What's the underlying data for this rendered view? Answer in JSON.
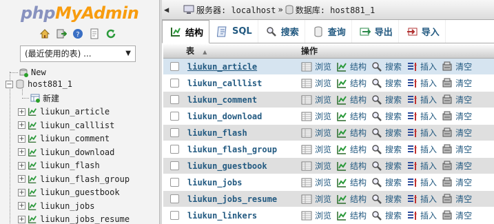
{
  "logo": {
    "part1": "php",
    "part2": "MyAdmin"
  },
  "nav": {
    "quick_icons": [
      "home-icon",
      "exit-icon",
      "help-icon",
      "docs-icon",
      "reload-icon"
    ],
    "recent_select": "(最近使用的表) ...",
    "new_label": "New",
    "db_name": "host881_1",
    "db_new_label": "新建",
    "tables": [
      "liukun_article",
      "liukun_calllist",
      "liukun_comment",
      "liukun_download",
      "liukun_flash",
      "liukun_flash_group",
      "liukun_guestbook",
      "liukun_jobs",
      "liukun_jobs_resume"
    ]
  },
  "breadcrumb": {
    "server_label": "服务器: localhost",
    "separator": "»",
    "db_label": "数据库: host881_1"
  },
  "tabs": [
    {
      "label": "结构",
      "icon": "structure-icon"
    },
    {
      "label": "SQL",
      "icon": "sql-icon"
    },
    {
      "label": "搜索",
      "icon": "search-icon"
    },
    {
      "label": "查询",
      "icon": "query-icon"
    },
    {
      "label": "导出",
      "icon": "export-icon"
    },
    {
      "label": "导入",
      "icon": "import-icon"
    }
  ],
  "table_header": {
    "name": "表",
    "sort": "▲",
    "ops": "操作"
  },
  "ops_labels": {
    "browse": "浏览",
    "structure": "结构",
    "search": "搜索",
    "insert": "插入",
    "empty": "清空"
  },
  "tables": [
    "liukun_article",
    "liukun_calllist",
    "liukun_comment",
    "liukun_download",
    "liukun_flash",
    "liukun_flash_group",
    "liukun_guestbook",
    "liukun_jobs",
    "liukun_jobs_resume",
    "liukun_linkers"
  ],
  "colors": {
    "link": "#235a81",
    "row_even": "#dfdfdf",
    "hover": "#d6e4f0"
  }
}
